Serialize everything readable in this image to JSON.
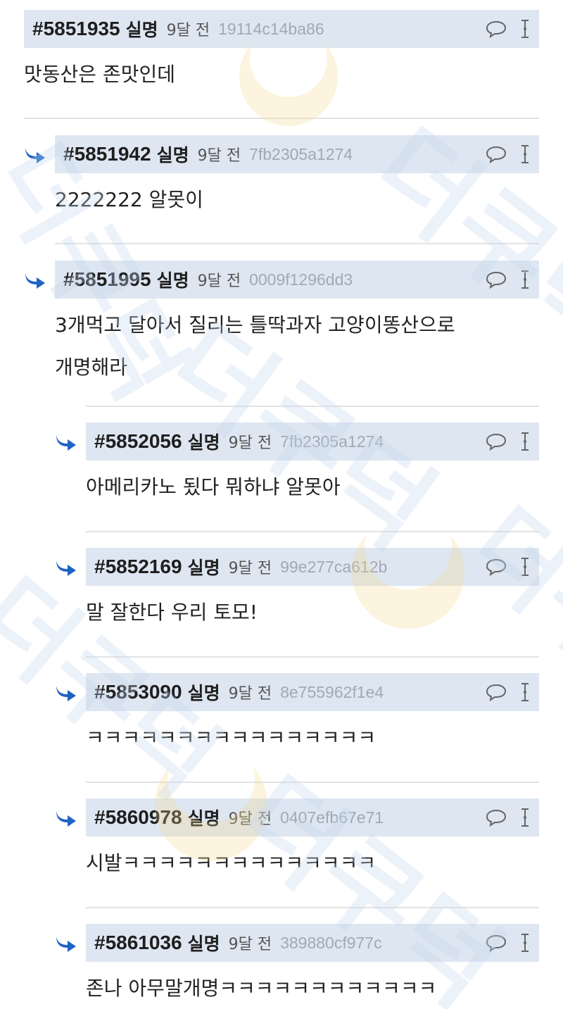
{
  "comments": [
    {
      "id": "#5851935",
      "author": "실명",
      "time": "9달 전",
      "hash": "19114c14ba86",
      "text": "맛동산은 존맛인데",
      "depth": 0
    },
    {
      "id": "#5851942",
      "author": "실명",
      "time": "9달 전",
      "hash": "7fb2305a1274",
      "text": "2222222 알못이",
      "depth": 1
    },
    {
      "id": "#5851995",
      "author": "실명",
      "time": "9달 전",
      "hash": "0009f1296dd3",
      "text_lines": [
        "3개먹고 달아서 질리는 틀딱과자 고양이똥산으로",
        "개명해라"
      ],
      "depth": 1
    },
    {
      "id": "#5852056",
      "author": "실명",
      "time": "9달 전",
      "hash": "7fb2305a1274",
      "text": "아메리카노 됬다 뭐하냐 알못아",
      "depth": 2
    },
    {
      "id": "#5852169",
      "author": "실명",
      "time": "9달 전",
      "hash": "99e277ca612b",
      "text": "말 잘한다 우리 토모!",
      "depth": 2
    },
    {
      "id": "#5853090",
      "author": "실명",
      "time": "9달 전",
      "hash": "8e755962f1e4",
      "text": "ㅋㅋㅋㅋㅋㅋㅋㅋㅋㅋㅋㅋㅋㅋㅋㅋ",
      "depth": 2
    },
    {
      "id": "#5860978",
      "author": "실명",
      "time": "9달 전",
      "hash": "0407efb67e71",
      "text": "시발ㅋㅋㅋㅋㅋㅋㅋㅋㅋㅋㅋㅋㅋㅋ",
      "depth": 2
    },
    {
      "id": "#5861036",
      "author": "실명",
      "time": "9달 전",
      "hash": "389880cf977c",
      "text": "존나 아무말개명ㅋㅋㅋㅋㅋㅋㅋㅋㅋㅋㅋㅋ",
      "depth": 2
    }
  ],
  "icons": {
    "reply_arrow": "reply-arrow-icon",
    "reply": "speech-bubble-icon",
    "more": "more-options-icon"
  },
  "colors": {
    "header_bg": "#dbe4f0",
    "reply_arrow": "#1f63c4",
    "hash_text": "#a3a9b1",
    "divider": "#e3e3e3"
  },
  "watermark": {
    "text": "더쿠덕"
  }
}
